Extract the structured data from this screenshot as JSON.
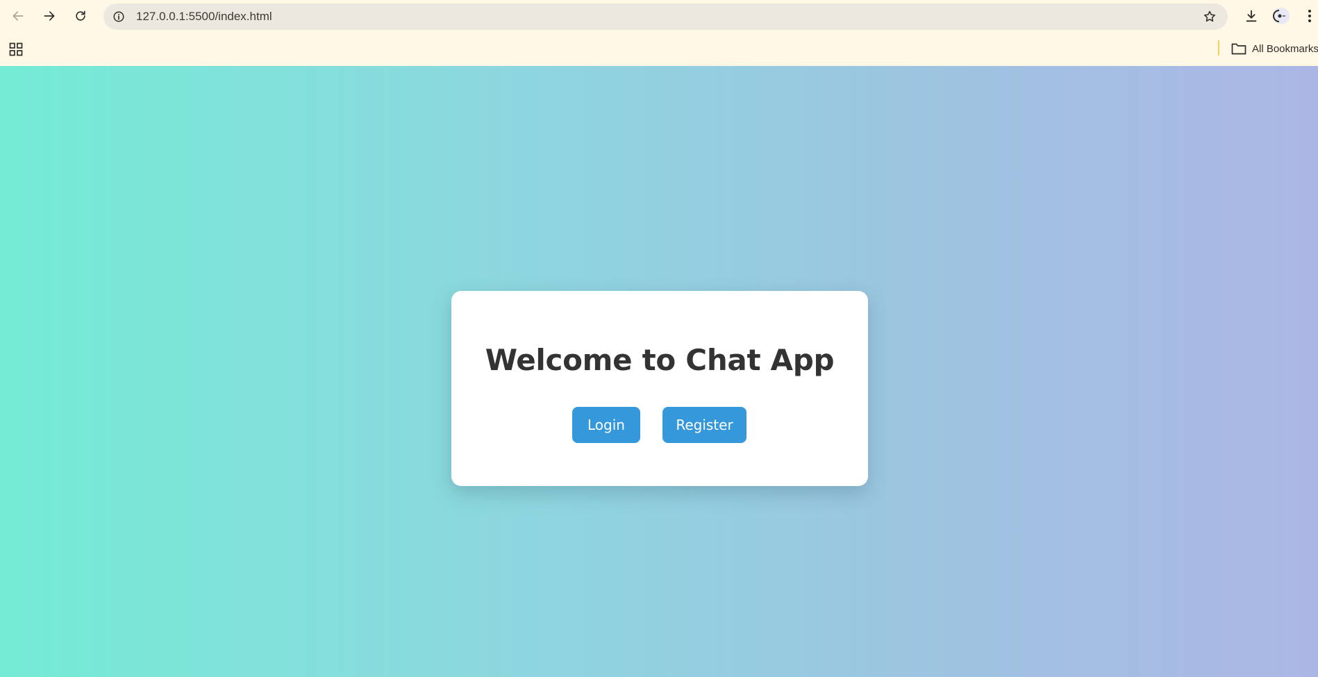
{
  "browser": {
    "url": "127.0.0.1:5500/index.html",
    "bookmarks_folder_label": "All Bookmarks",
    "icons": {
      "back": "back-arrow-icon",
      "forward": "forward-arrow-icon",
      "reload": "reload-icon",
      "site_info": "info-icon",
      "bookmark_star": "star-icon",
      "downloads": "download-icon",
      "profile": "profile-icon",
      "menu": "kebab-menu-icon",
      "apps": "apps-grid-icon",
      "folder": "folder-icon"
    }
  },
  "page": {
    "heading": "Welcome to Chat App",
    "login_label": "Login",
    "register_label": "Register",
    "colors": {
      "gradient_start": "#74ebd5",
      "gradient_end": "#acb6e5",
      "button": "#3498db",
      "card": "#ffffff",
      "heading": "#333333"
    }
  }
}
